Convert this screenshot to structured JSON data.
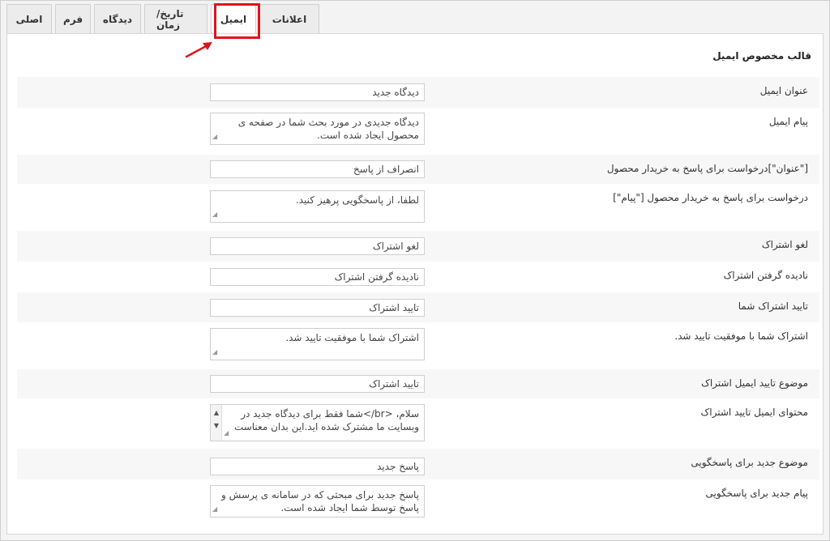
{
  "tabs": [
    {
      "label": "اصلی"
    },
    {
      "label": "فرم"
    },
    {
      "label": "دیدگاه"
    },
    {
      "label": "تاریخ/زمان"
    },
    {
      "label": "ایمیل"
    },
    {
      "label": "اعلانات"
    }
  ],
  "active_tab": "ایمیل",
  "section_title": "قالب مخصوص ایمیل",
  "rows": [
    {
      "label": "عنوان ایمیل",
      "value": "دیدگاه جدید",
      "type": "single"
    },
    {
      "label": "پیام ایمیل",
      "value": "دیدگاه جدیدی در مورد بحث شما در صفحه ی محصول ایجاد شده است.",
      "type": "multi"
    },
    {
      "label": "[\"عنوان\"]درخواست برای پاسخ به خریدار محصول",
      "value": "انصراف از پاسخ",
      "type": "single"
    },
    {
      "label": "درخواست برای پاسخ به خریدار محصول [\"پیام\"]",
      "value": "لطفا، از پاسخگویی پرهیز کنید.",
      "type": "multi"
    },
    {
      "label": "لغو اشتراک",
      "value": "لغو اشتراک",
      "type": "single"
    },
    {
      "label": "نادیده گرفتن اشتراک",
      "value": "نادیده گرفتن اشتراک",
      "type": "single"
    },
    {
      "label": "تایید اشتراک شما",
      "value": "تایید اشتراک",
      "type": "single"
    },
    {
      "label": "اشتراک شما با موفقیت تایید شد.",
      "value": "اشتراک شما با موفقیت تایید شد.",
      "type": "multi"
    },
    {
      "label": "موضوع تایید ایمیل اشتراک",
      "value": "تایید اشتراک",
      "type": "single"
    },
    {
      "label": "محتوای ایمیل تایید اشتراک",
      "value": "سلام، <br/>شما فقط برای دیدگاه جدید در وبسایت ما مشترک شده اید.این بدان معناست",
      "type": "scroll"
    },
    {
      "label": "موضوع جدید برای پاسخگویی",
      "value": "پاسخ جدید",
      "type": "single"
    },
    {
      "label": "پیام جدید برای پاسخگویی",
      "value": "پاسخ جدید برای مبحثی که در سامانه ی پرسش و پاسخ توسط شما ایجاد شده است.",
      "type": "multi"
    }
  ],
  "colors": {
    "highlight": "#e0141b",
    "arrow": "#e0141b"
  }
}
